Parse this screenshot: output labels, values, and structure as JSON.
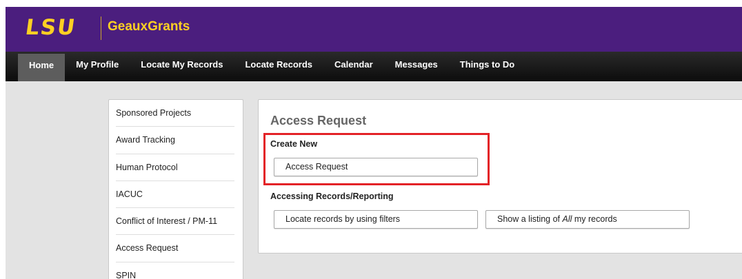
{
  "header": {
    "logo_text": "LSU",
    "app_name": "GeauxGrants",
    "brand_color": "#4b1e7e",
    "accent_color": "#fdd023"
  },
  "nav": {
    "items": [
      {
        "label": "Home",
        "active": true
      },
      {
        "label": "My Profile"
      },
      {
        "label": "Locate My Records"
      },
      {
        "label": "Locate Records"
      },
      {
        "label": "Calendar"
      },
      {
        "label": "Messages"
      },
      {
        "label": "Things to Do"
      }
    ]
  },
  "sidebar": {
    "items": [
      {
        "label": "Sponsored Projects"
      },
      {
        "label": "Award Tracking"
      },
      {
        "label": "Human Protocol"
      },
      {
        "label": "IACUC"
      },
      {
        "label": "Conflict of Interest / PM-11"
      },
      {
        "label": "Access Request"
      },
      {
        "label": "SPIN"
      }
    ]
  },
  "main": {
    "title": "Access Request",
    "create_new": {
      "label": "Create New",
      "button_label": "Access Request"
    },
    "accessing": {
      "label": "Accessing Records/Reporting",
      "filters_button": "Locate records by using filters",
      "listing_button": {
        "prefix": "Show a listing of ",
        "emphasis": "All",
        "suffix": " my records"
      }
    },
    "highlight_color": "#e32227"
  }
}
